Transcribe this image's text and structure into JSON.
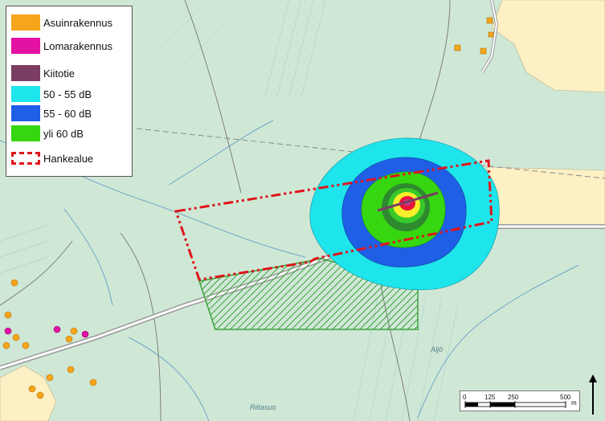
{
  "legend": {
    "items": [
      {
        "label": "Asuinrakennus",
        "color": "#f7a51b",
        "style": "fill"
      },
      {
        "label": "Lomarakennus",
        "color": "#e312a4",
        "style": "fill"
      },
      {
        "label": "Kiitotie",
        "color": "#7b3d64",
        "style": "fill"
      },
      {
        "label": "50 - 55 dB",
        "color": "#1ee4ec",
        "style": "fill"
      },
      {
        "label": "55 - 60 dB",
        "color": "#1f5fe6",
        "style": "fill"
      },
      {
        "label": "yli 60 dB",
        "color": "#36d611",
        "style": "fill"
      },
      {
        "label": "Hankealue",
        "color": "#e0141b",
        "style": "dashed"
      }
    ]
  },
  "scale": {
    "labels": [
      "0",
      "125",
      "250",
      "500"
    ],
    "unit": "m"
  },
  "places": {
    "south": "Riitasuo",
    "creek": "Aljö"
  },
  "colors": {
    "background": "#cfe8d6",
    "field": "#fdf0c4",
    "noise_low": "#1ee4ec",
    "noise_mid": "#1f5fe6",
    "noise_high": "#36d611",
    "core_dark_green": "#2e8a2e",
    "core_yellow": "#f6ef2a",
    "core_red": "#e8143a",
    "runway": "#7b3d64",
    "project_area": "#e0141b",
    "hatch_area": "#3aa13a"
  }
}
